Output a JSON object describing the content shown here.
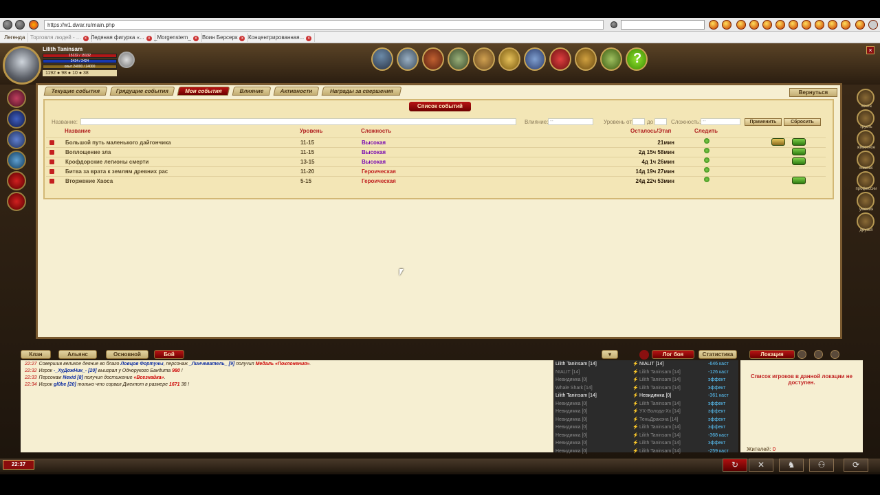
{
  "browser": {
    "url": "https://w1.dwar.ru/main.php",
    "tabs": [
      "Легенда",
      "Торговля людей - ...",
      "Ледяная фигурка «...",
      "_Morgenstern_",
      "Воин Берсерк",
      "Концентрированная..."
    ]
  },
  "character": {
    "name": "Lilith Taninsam",
    "hp": "15132 / 15132",
    "mp": "2424 / 2424",
    "exp": "опыт 24000 / 24000",
    "money": "1192",
    "silver": "98",
    "gold": "10",
    "bronze": "38"
  },
  "tabs": [
    "Текущие события",
    "Грядущие события",
    "Мои события",
    "Влияние",
    "Активности",
    "Награды за свершения"
  ],
  "back_label": "Вернуться",
  "frame_title": "Список событий",
  "filters": {
    "name_label": "Название:",
    "influence_label": "Влияние:",
    "influence_value": "--",
    "level_label": "Уровень от",
    "level_to_label": "до",
    "difficulty_label": "Сложность:",
    "difficulty_value": "--",
    "apply": "Применить",
    "reset": "Сбросить"
  },
  "columns": {
    "name": "Название",
    "level": "Уровень",
    "difficulty": "Сложность",
    "remaining": "Осталось/Этап",
    "follow": "Следить"
  },
  "events": [
    {
      "name": "Большой путь маленького дайгончика",
      "level": "11-15",
      "difficulty": "Высокая",
      "kind": "high",
      "remaining": "21мин",
      "icons": 2
    },
    {
      "name": "Воплощение зла",
      "level": "11-15",
      "difficulty": "Высокая",
      "kind": "high",
      "remaining": "2д 15ч 58мин",
      "icons": 1
    },
    {
      "name": "Крофдорские легионы смерти",
      "level": "13-15",
      "difficulty": "Высокая",
      "kind": "high",
      "remaining": "4д 1ч 26мин",
      "icons": 1
    },
    {
      "name": "Битва за врата к землям древних рас",
      "level": "11-20",
      "difficulty": "Героическая",
      "kind": "hero",
      "remaining": "14д 19ч 27мин",
      "icons": 0
    },
    {
      "name": "Вторжение Хаоса",
      "level": "5-15",
      "difficulty": "Героическая",
      "kind": "hero",
      "remaining": "24д 22ч 53мин",
      "icons": 1
    }
  ],
  "chat_tabs": [
    "Клан",
    "Альянс",
    "Основной",
    "Бой"
  ],
  "battle_tabs": [
    "Лог боя",
    "Статистика"
  ],
  "location_tab": "Локация",
  "chat": [
    {
      "time": "22:27",
      "a": "Совершив великое деяние во благо ",
      "b": "Ловцов Фортуны",
      "c": ", персонаж ",
      "d": "_Линчеватель_ [9]",
      "e": " получил ",
      "f": "Медаль «Поклонения»",
      "g": "."
    },
    {
      "time": "22:32",
      "a": "Игрок ",
      "b": "-_ХуДожНик_- [20]",
      "c": " выиграл у Однорукого Бандита ",
      "d": "980",
      "e": " !",
      "f": "",
      "g": ""
    },
    {
      "time": "22:33",
      "a": "Персонаж ",
      "b": "Nexid [8]",
      "c": " получил достижение ",
      "d": "«Всезнайка»",
      "e": ".",
      "f": "",
      "g": ""
    },
    {
      "time": "22:34",
      "a": "Игрок ",
      "b": "gl0be [20]",
      "c": " только что сорвал Джекпот в размере ",
      "d": "1671",
      "e": " 38 !",
      "f": "",
      "g": ""
    }
  ],
  "battle_log": [
    {
      "a": "Lilith Taninsam [14]",
      "b": "NIALIT [14]",
      "c": "-646 каст",
      "hi": true
    },
    {
      "a": "NIALIT [14]",
      "b": "Lilith Taninsam [14]",
      "c": "-126 каст",
      "hi": false
    },
    {
      "a": "Невидимка [0]",
      "b": "Lilith Taninsam [14]",
      "c": "эффект",
      "hi": false
    },
    {
      "a": "Whale Shark [14]",
      "b": "Lilith Taninsam [14]",
      "c": "эффект",
      "hi": false
    },
    {
      "a": "Lilith Taninsam [14]",
      "b": "Невидимка [0]",
      "c": "-361 каст",
      "hi": true
    },
    {
      "a": "Невидимка [0]",
      "b": "Lilith Taninsam [14]",
      "c": "эффект",
      "hi": false
    },
    {
      "a": "Невидимка [0]",
      "b": "УХ-Волода-Хх [14]",
      "c": "эффект",
      "hi": false
    },
    {
      "a": "Невидимка [0]",
      "b": "ТеньДракона [14]",
      "c": "эффект",
      "hi": false
    },
    {
      "a": "Невидимка [0]",
      "b": "Lilith Taninsam [14]",
      "c": "эффект",
      "hi": false
    },
    {
      "a": "Невидимка [0]",
      "b": "Lilith Taninsam [14]",
      "c": "-368 каст",
      "hi": false
    },
    {
      "a": "Невидимка [0]",
      "b": "Lilith Taninsam [14]",
      "c": "эффект",
      "hi": false
    },
    {
      "a": "Невидимка [0]",
      "b": "Lilith Taninsam [14]",
      "c": "-259 каст",
      "hi": false
    }
  ],
  "location": {
    "message": "Список игроков в данной локации не доступен.",
    "residents_label": "Жителей:",
    "residents_count": "0"
  },
  "side_labels": [
    "почта",
    "грусть",
    "животное",
    "компас",
    "профессии",
    "умения",
    "друзья"
  ],
  "clock": "22:37"
}
